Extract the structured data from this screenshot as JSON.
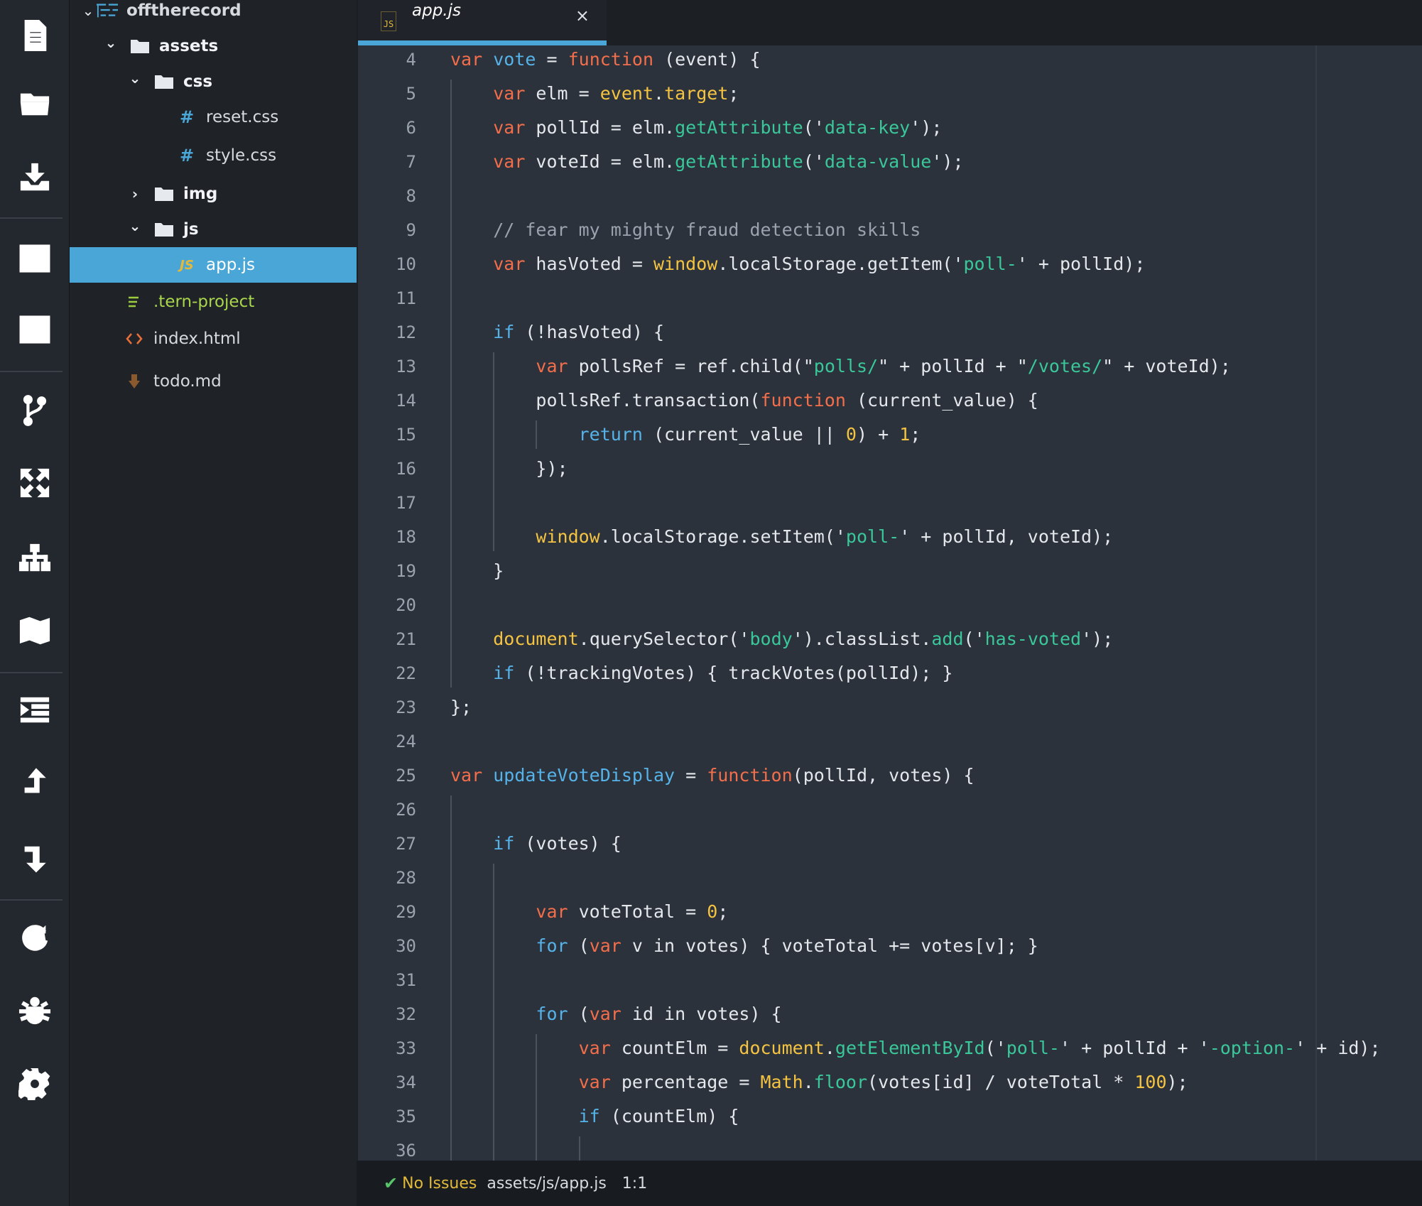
{
  "project": {
    "root_name": "offtherecord",
    "tree": [
      {
        "label": "assets",
        "kind": "folder",
        "state": "open"
      },
      {
        "label": "css",
        "kind": "folder",
        "state": "open"
      },
      {
        "label": "reset.css",
        "kind": "css-file"
      },
      {
        "label": "style.css",
        "kind": "css-file"
      },
      {
        "label": "img",
        "kind": "folder",
        "state": "closed"
      },
      {
        "label": "js",
        "kind": "folder",
        "state": "open"
      },
      {
        "label": "app.js",
        "kind": "js-file",
        "selected": true
      },
      {
        "label": ".tern-project",
        "kind": "config-file"
      },
      {
        "label": "index.html",
        "kind": "html-file"
      },
      {
        "label": "todo.md",
        "kind": "markdown-file"
      }
    ],
    "glyphs": {
      "chevron_open": "⌄",
      "chevron_closed": "›",
      "hash": "#",
      "js": "JS"
    }
  },
  "tab": {
    "label": "app.js",
    "close_glyph": "×",
    "icon_text": "JS"
  },
  "activity_bar": {
    "icons": [
      "file-icon",
      "folder-icon",
      "download-icon",
      "split-vertical-icon",
      "split-horizontal-icon",
      "git-branch-icon",
      "fullscreen-icon",
      "sitemap-icon",
      "map-icon",
      "indent-icon",
      "upload-icon",
      "download-arrow-icon",
      "refresh-icon",
      "bug-icon",
      "settings-icon"
    ]
  },
  "editor": {
    "line_numbers": [
      "4",
      "5",
      "6",
      "7",
      "8",
      "9",
      "10",
      "11",
      "12",
      "13",
      "14",
      "15",
      "16",
      "17",
      "18",
      "19",
      "20",
      "21",
      "22",
      "23",
      "24",
      "25",
      "26",
      "27",
      "28",
      "29",
      "30",
      "31",
      "32",
      "33",
      "34",
      "35",
      "36"
    ],
    "lines": [
      [
        {
          "t": "var",
          "c": "k"
        },
        {
          "t": " ",
          "c": "p"
        },
        {
          "t": "vote",
          "c": "c"
        },
        {
          "t": " = ",
          "c": "p"
        },
        {
          "t": "function",
          "c": "k"
        },
        {
          "t": " (event) {",
          "c": "p"
        }
      ],
      [
        {
          "t": "    ",
          "c": "p"
        },
        {
          "t": "var",
          "c": "k"
        },
        {
          "t": " elm = ",
          "c": "p"
        },
        {
          "t": "event",
          "c": "g"
        },
        {
          "t": ".",
          "c": "p"
        },
        {
          "t": "target",
          "c": "g"
        },
        {
          "t": ";",
          "c": "p"
        }
      ],
      [
        {
          "t": "    ",
          "c": "p"
        },
        {
          "t": "var",
          "c": "k"
        },
        {
          "t": " pollId = elm.",
          "c": "p"
        },
        {
          "t": "getAttribute",
          "c": "s"
        },
        {
          "t": "('",
          "c": "p"
        },
        {
          "t": "data-key",
          "c": "s"
        },
        {
          "t": "');",
          "c": "p"
        }
      ],
      [
        {
          "t": "    ",
          "c": "p"
        },
        {
          "t": "var",
          "c": "k"
        },
        {
          "t": " voteId = elm.",
          "c": "p"
        },
        {
          "t": "getAttribute",
          "c": "s"
        },
        {
          "t": "('",
          "c": "p"
        },
        {
          "t": "data-value",
          "c": "s"
        },
        {
          "t": "');",
          "c": "p"
        }
      ],
      [],
      [
        {
          "t": "    ",
          "c": "p"
        },
        {
          "t": "// fear my mighty fraud detection skills",
          "c": "cm"
        }
      ],
      [
        {
          "t": "    ",
          "c": "p"
        },
        {
          "t": "var",
          "c": "k"
        },
        {
          "t": " hasVoted = ",
          "c": "p"
        },
        {
          "t": "window",
          "c": "g"
        },
        {
          "t": ".localStorage.getItem('",
          "c": "p"
        },
        {
          "t": "poll-",
          "c": "s"
        },
        {
          "t": "' + pollId);",
          "c": "p"
        }
      ],
      [],
      [
        {
          "t": "    ",
          "c": "p"
        },
        {
          "t": "if",
          "c": "c"
        },
        {
          "t": " (!hasVoted) {",
          "c": "p"
        }
      ],
      [
        {
          "t": "        ",
          "c": "p"
        },
        {
          "t": "var",
          "c": "k"
        },
        {
          "t": " pollsRef = ref.child(\"",
          "c": "p"
        },
        {
          "t": "polls/",
          "c": "s"
        },
        {
          "t": "\" + pollId + \"",
          "c": "p"
        },
        {
          "t": "/votes/",
          "c": "s"
        },
        {
          "t": "\" + voteId);",
          "c": "p"
        }
      ],
      [
        {
          "t": "        pollsRef.transaction(",
          "c": "p"
        },
        {
          "t": "function",
          "c": "k"
        },
        {
          "t": " (current_value) {",
          "c": "p"
        }
      ],
      [
        {
          "t": "            ",
          "c": "p"
        },
        {
          "t": "return",
          "c": "c"
        },
        {
          "t": " (current_value || ",
          "c": "p"
        },
        {
          "t": "0",
          "c": "n"
        },
        {
          "t": ") + ",
          "c": "p"
        },
        {
          "t": "1",
          "c": "n"
        },
        {
          "t": ";",
          "c": "p"
        }
      ],
      [
        {
          "t": "        });",
          "c": "p"
        }
      ],
      [],
      [
        {
          "t": "        ",
          "c": "p"
        },
        {
          "t": "window",
          "c": "g"
        },
        {
          "t": ".localStorage.setItem('",
          "c": "p"
        },
        {
          "t": "poll-",
          "c": "s"
        },
        {
          "t": "' + pollId, voteId);",
          "c": "p"
        }
      ],
      [
        {
          "t": "    }",
          "c": "p"
        }
      ],
      [],
      [
        {
          "t": "    ",
          "c": "p"
        },
        {
          "t": "document",
          "c": "g"
        },
        {
          "t": ".querySelector('",
          "c": "p"
        },
        {
          "t": "body",
          "c": "s"
        },
        {
          "t": "').classList.",
          "c": "p"
        },
        {
          "t": "add",
          "c": "s"
        },
        {
          "t": "('",
          "c": "p"
        },
        {
          "t": "has-voted",
          "c": "s"
        },
        {
          "t": "');",
          "c": "p"
        }
      ],
      [
        {
          "t": "    ",
          "c": "p"
        },
        {
          "t": "if",
          "c": "c"
        },
        {
          "t": " (!trackingVotes) { trackVotes(pollId); }",
          "c": "p"
        }
      ],
      [
        {
          "t": "};",
          "c": "p"
        }
      ],
      [],
      [
        {
          "t": "var",
          "c": "k"
        },
        {
          "t": " ",
          "c": "p"
        },
        {
          "t": "updateVoteDisplay",
          "c": "c"
        },
        {
          "t": " = ",
          "c": "p"
        },
        {
          "t": "function",
          "c": "k"
        },
        {
          "t": "(pollId, votes) {",
          "c": "p"
        }
      ],
      [],
      [
        {
          "t": "    ",
          "c": "p"
        },
        {
          "t": "if",
          "c": "c"
        },
        {
          "t": " (votes) {",
          "c": "p"
        }
      ],
      [],
      [
        {
          "t": "        ",
          "c": "p"
        },
        {
          "t": "var",
          "c": "k"
        },
        {
          "t": " voteTotal = ",
          "c": "p"
        },
        {
          "t": "0",
          "c": "n"
        },
        {
          "t": ";",
          "c": "p"
        }
      ],
      [
        {
          "t": "        ",
          "c": "p"
        },
        {
          "t": "for",
          "c": "c"
        },
        {
          "t": " (",
          "c": "p"
        },
        {
          "t": "var",
          "c": "k"
        },
        {
          "t": " v in votes) { voteTotal += votes[v]; }",
          "c": "p"
        }
      ],
      [],
      [
        {
          "t": "        ",
          "c": "p"
        },
        {
          "t": "for",
          "c": "c"
        },
        {
          "t": " (",
          "c": "p"
        },
        {
          "t": "var",
          "c": "k"
        },
        {
          "t": " id in votes) {",
          "c": "p"
        }
      ],
      [
        {
          "t": "            ",
          "c": "p"
        },
        {
          "t": "var",
          "c": "k"
        },
        {
          "t": " countElm = ",
          "c": "p"
        },
        {
          "t": "document",
          "c": "g"
        },
        {
          "t": ".",
          "c": "p"
        },
        {
          "t": "getElementById",
          "c": "s"
        },
        {
          "t": "('",
          "c": "p"
        },
        {
          "t": "poll-",
          "c": "s"
        },
        {
          "t": "' + pollId + '",
          "c": "p"
        },
        {
          "t": "-option-",
          "c": "s"
        },
        {
          "t": "' + id);",
          "c": "p"
        }
      ],
      [
        {
          "t": "            ",
          "c": "p"
        },
        {
          "t": "var",
          "c": "k"
        },
        {
          "t": " percentage = ",
          "c": "p"
        },
        {
          "t": "Math",
          "c": "g"
        },
        {
          "t": ".",
          "c": "p"
        },
        {
          "t": "floor",
          "c": "s"
        },
        {
          "t": "(votes[id] / voteTotal * ",
          "c": "p"
        },
        {
          "t": "100",
          "c": "n"
        },
        {
          "t": ");",
          "c": "p"
        }
      ],
      [
        {
          "t": "            ",
          "c": "p"
        },
        {
          "t": "if",
          "c": "c"
        },
        {
          "t": " (countElm) {",
          "c": "p"
        }
      ],
      []
    ]
  },
  "status": {
    "icon": "✔",
    "issues": "No Issues",
    "path": "assets/js/app.js",
    "cursor": "1:1"
  }
}
